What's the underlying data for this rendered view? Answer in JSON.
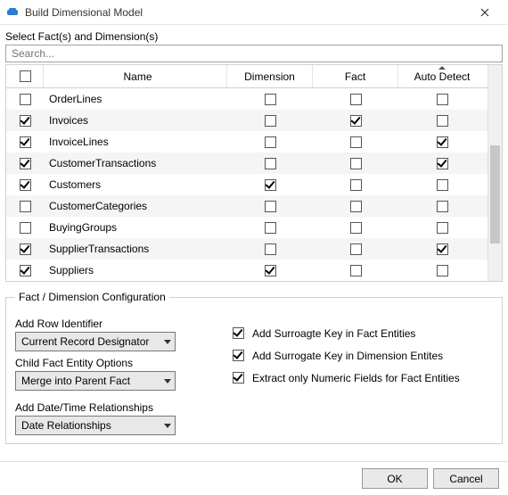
{
  "window": {
    "title": "Build Dimensional Model"
  },
  "selection": {
    "label": "Select Fact(s) and Dimension(s)",
    "search_placeholder": "Search..."
  },
  "columns": {
    "name": "Name",
    "dimension": "Dimension",
    "fact": "Fact",
    "auto": "Auto Detect"
  },
  "rows": [
    {
      "name": "OrderLines",
      "sel": false,
      "dim": false,
      "fact": false,
      "auto": false
    },
    {
      "name": "Invoices",
      "sel": true,
      "dim": false,
      "fact": true,
      "auto": false
    },
    {
      "name": "InvoiceLines",
      "sel": true,
      "dim": false,
      "fact": false,
      "auto": true
    },
    {
      "name": "CustomerTransactions",
      "sel": true,
      "dim": false,
      "fact": false,
      "auto": true
    },
    {
      "name": "Customers",
      "sel": true,
      "dim": true,
      "fact": false,
      "auto": false
    },
    {
      "name": "CustomerCategories",
      "sel": false,
      "dim": false,
      "fact": false,
      "auto": false
    },
    {
      "name": "BuyingGroups",
      "sel": false,
      "dim": false,
      "fact": false,
      "auto": false
    },
    {
      "name": "SupplierTransactions",
      "sel": true,
      "dim": false,
      "fact": false,
      "auto": true
    },
    {
      "name": "Suppliers",
      "sel": true,
      "dim": true,
      "fact": false,
      "auto": false
    }
  ],
  "config": {
    "legend": "Fact / Dimension Configuration",
    "row_id_label": "Add Row Identifier",
    "row_id_value": "Current Record Designator",
    "child_fact_label": "Child Fact Entity Options",
    "child_fact_value": "Merge into Parent Fact",
    "date_rel_label": "Add Date/Time Relationships",
    "date_rel_value": "Date Relationships",
    "opt_surrogate_fact": "Add Surroagte Key in Fact Entities",
    "opt_surrogate_dim": "Add Surrogate Key in Dimension Entites",
    "opt_numeric_only": "Extract only Numeric Fields for Fact Entities"
  },
  "buttons": {
    "ok": "OK",
    "cancel": "Cancel"
  }
}
